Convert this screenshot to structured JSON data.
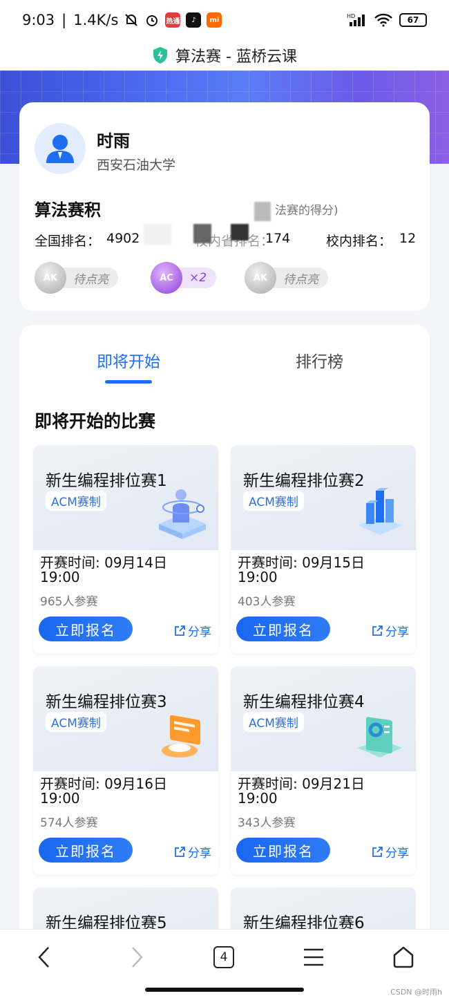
{
  "status_bar": {
    "time": "9:03",
    "speed": "1.4K/s",
    "battery": "67",
    "apps": [
      {
        "name": "郑通",
        "color": "#e63b3b"
      },
      {
        "name": "tiktok",
        "color": "#111111"
      },
      {
        "name": "mi",
        "color": "#ff6a00"
      }
    ]
  },
  "title_bar": {
    "title": "算法赛 - 蓝桥云课",
    "accent": "#2bbf9a"
  },
  "profile": {
    "name": "时雨",
    "school": "西安石油大学",
    "score_title": "算法赛积",
    "score_note": "法赛的得分)",
    "national_rank_label": "全国排名：",
    "national_rank_value": "4902",
    "province_rank_label": "校内省排名：",
    "province_rank_value": "174",
    "school_rank_label": "校内排名：",
    "school_rank_value": "12",
    "badges": [
      {
        "icon": "AK",
        "label": "待点亮",
        "style": "gray"
      },
      {
        "icon": "AC",
        "label": "×2",
        "style": "purple"
      },
      {
        "icon": "AK",
        "label": "待点亮",
        "style": "gray"
      }
    ]
  },
  "tabs": {
    "upcoming": "即将开始",
    "ranking": "排行榜"
  },
  "section_title": "即将开始的比赛",
  "contests": [
    {
      "name": "新生编程排位赛1",
      "tag": "ACM赛制",
      "time": "开赛时间: 09月14日\n19:00",
      "time_date": "开赛时间: 09月14日",
      "time_clock": "19:00",
      "count": "965人参赛",
      "button": "立即报名",
      "share": "分享",
      "illustration": "person-icon"
    },
    {
      "name": "新生编程排位赛2",
      "tag": "ACM赛制",
      "time_date": "开赛时间: 09月15日",
      "time_clock": "19:00",
      "count": "403人参赛",
      "button": "立即报名",
      "share": "分享",
      "illustration": "chart-blocks-icon"
    },
    {
      "name": "新生编程排位赛3",
      "tag": "ACM赛制",
      "time_date": "开赛时间: 09月16日",
      "time_clock": "19:00",
      "count": "574人参赛",
      "button": "立即报名",
      "share": "分享",
      "illustration": "document-icon"
    },
    {
      "name": "新生编程排位赛4",
      "tag": "ACM赛制",
      "time_date": "开赛时间: 09月21日",
      "time_clock": "19:00",
      "count": "343人参赛",
      "button": "立即报名",
      "share": "分享",
      "illustration": "pie-report-icon"
    },
    {
      "name": "新生编程排位赛5"
    },
    {
      "name": "新生编程排位赛6"
    }
  ],
  "bottom_nav": {
    "tab_count": "4",
    "watermark": "CSDN @时雨h"
  }
}
